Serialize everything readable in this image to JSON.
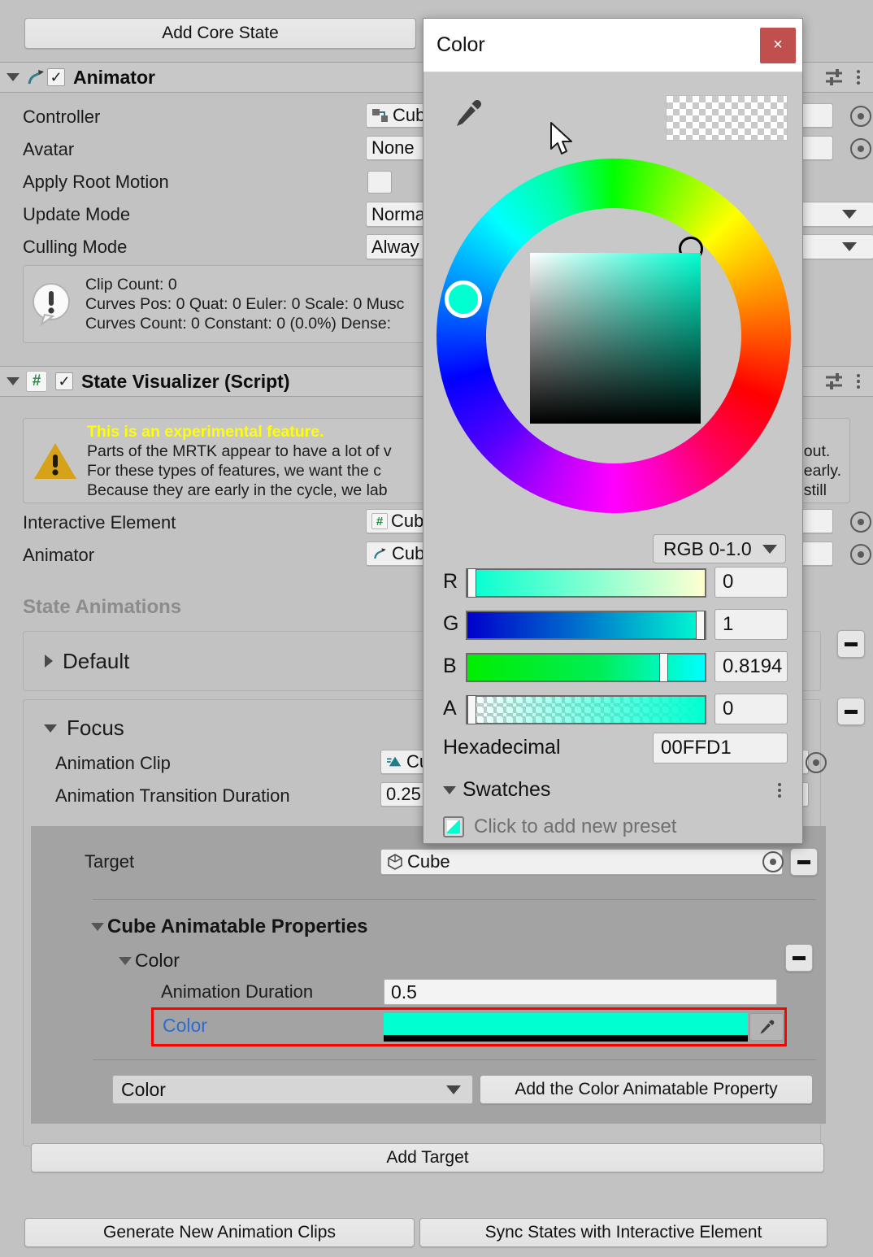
{
  "inspector": {
    "add_core_state_button": "Add Core State",
    "animator": {
      "title": "Animator",
      "checkbox_checked": "✓",
      "fields": [
        {
          "label": "Controller",
          "value": "Cub",
          "icon": "animator-controller-icon",
          "has_picker": true
        },
        {
          "label": "Avatar",
          "value": "None",
          "icon": "",
          "has_picker": true
        },
        {
          "label": "Apply Root Motion",
          "value": "",
          "icon": "",
          "type": "checkbox"
        },
        {
          "label": "Update Mode",
          "value": "Norma",
          "icon": "",
          "type": "dropdown"
        },
        {
          "label": "Culling Mode",
          "value": "Alway",
          "icon": "",
          "type": "dropdown"
        }
      ],
      "info_lines": [
        "Clip Count: 0",
        "Curves Pos: 0 Quat: 0 Euler: 0 Scale: 0 Musc",
        "Curves Count: 0 Constant: 0 (0.0%) Dense:"
      ]
    },
    "state_visualizer": {
      "title": "State Visualizer (Script)",
      "checkbox_checked": "✓",
      "warning_heading": "This is an experimental feature.",
      "warning_lines_left": [
        "Parts of the MRTK appear to have a lot of v",
        "For these types of features, we want the c",
        "Because they are early in the cycle, we lab"
      ],
      "warning_lines_right": [
        "d out.",
        "n early.",
        "e still"
      ],
      "fields": [
        {
          "label": "Interactive Element",
          "value": "Cub",
          "icon": "script-hash-icon"
        },
        {
          "label": "Animator",
          "value": "Cub",
          "icon": "animator-icon"
        }
      ],
      "state_animations_heading": "State Animations",
      "states": [
        {
          "name": "Default",
          "expanded": false
        },
        {
          "name": "Focus",
          "expanded": true
        }
      ],
      "focus": {
        "animation_clip_label": "Animation Clip",
        "animation_clip_value": "Cu",
        "transition_duration_label": "Animation Transition Duration",
        "transition_duration_value": "0.25"
      },
      "target_panel": {
        "target_label": "Target",
        "target_value": "Cube",
        "target_icon": "cube-icon",
        "animatable_properties_heading": "Cube Animatable Properties",
        "color_group_label": "Color",
        "animation_duration_label": "Animation Duration",
        "animation_duration_value": "0.5",
        "color_label": "Color",
        "color_value_hex": "#00FFD1",
        "highlight_color": "#ff0000",
        "property_dropdown_value": "Color",
        "add_property_button": "Add the Color Animatable Property"
      },
      "add_target_button": "Add Target"
    },
    "bottom_buttons": {
      "generate": "Generate New Animation Clips",
      "sync": "Sync States with Interactive Element"
    },
    "minus_button_label": "–"
  },
  "color_dialog": {
    "title": "Color",
    "close_label": "×",
    "eyedropper_icon": "eyedropper-icon",
    "mode_dropdown": "RGB 0-1.0",
    "channels": [
      {
        "label": "R",
        "value": "0",
        "knob_pct": 0.5
      },
      {
        "label": "G",
        "value": "1",
        "knob_pct": 97.5
      },
      {
        "label": "B",
        "value": "0.8194",
        "knob_pct": 81.94
      },
      {
        "label": "A",
        "value": "0",
        "knob_pct": 0.5
      }
    ],
    "hex_label": "Hexadecimal",
    "hex_value": "00FFD1",
    "swatches_label": "Swatches",
    "swatches_hint": "Click to add new preset",
    "selected_color": "#00FFD1"
  }
}
